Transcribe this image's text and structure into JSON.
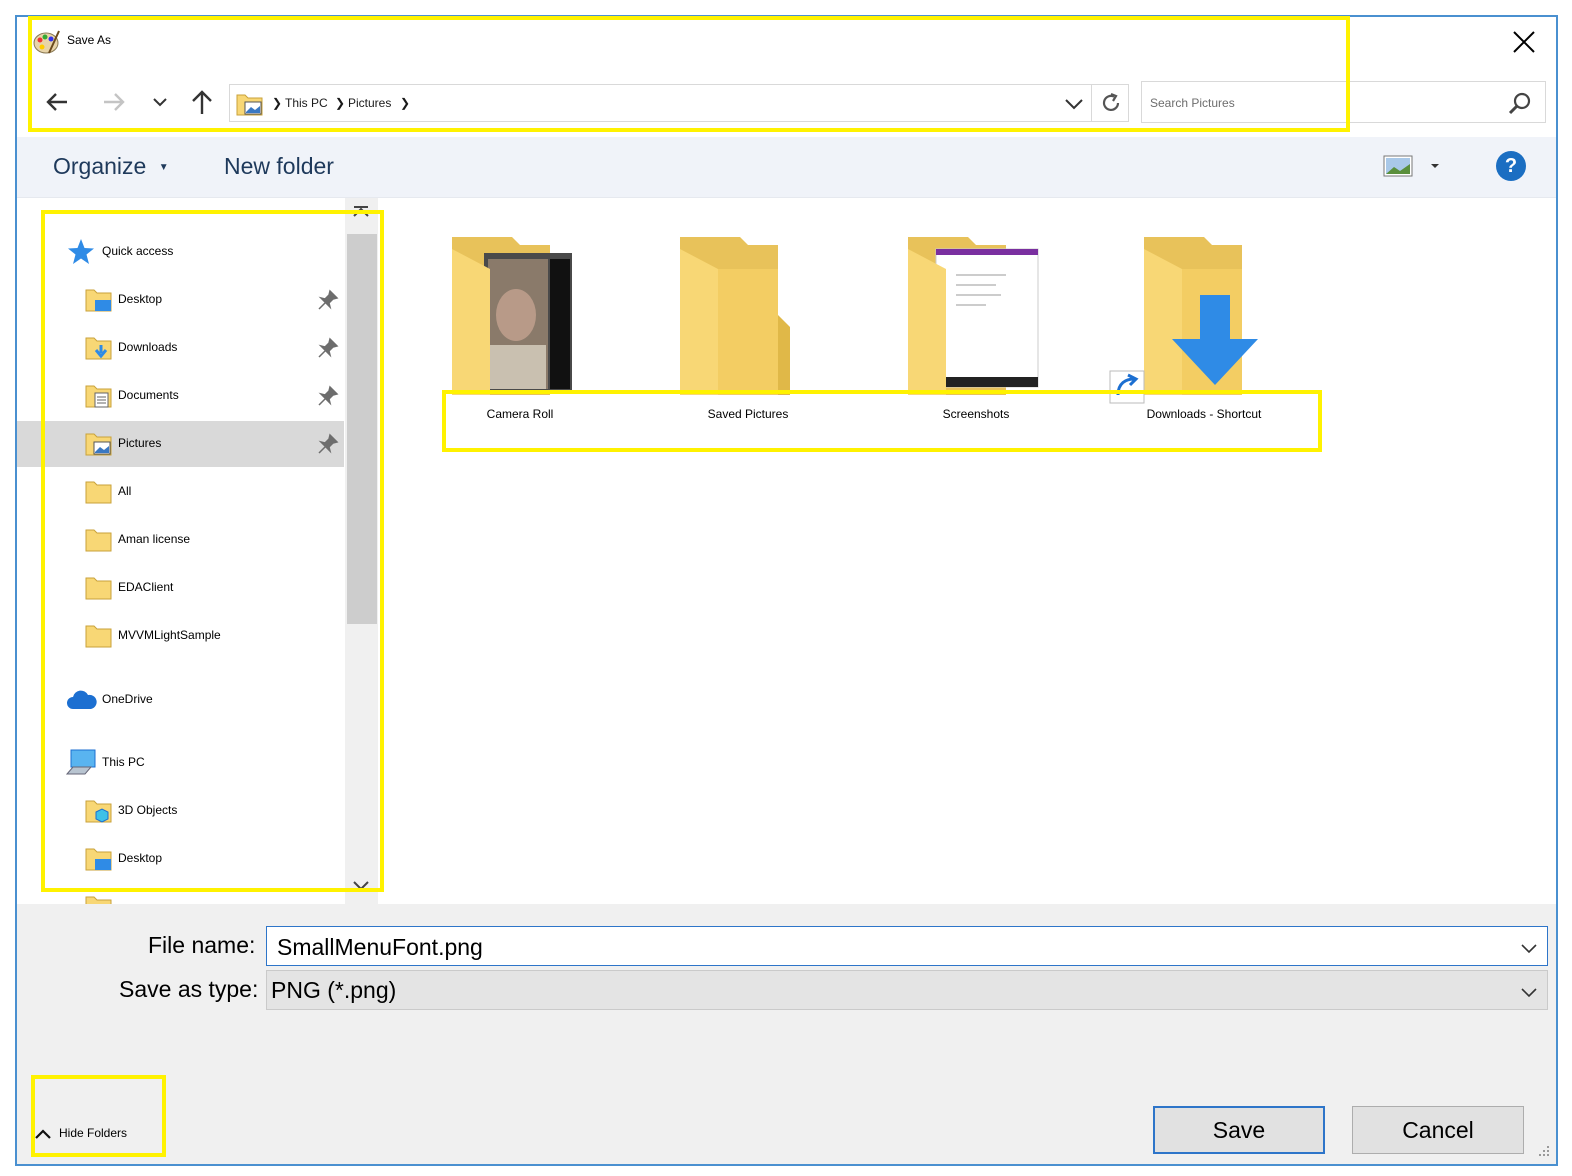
{
  "window": {
    "title": "Save As"
  },
  "address_bar": {
    "crumbs": [
      "This PC",
      "Pictures"
    ]
  },
  "search": {
    "placeholder": "Search Pictures"
  },
  "toolbar": {
    "organize": "Organize",
    "new_folder": "New folder",
    "help": "?"
  },
  "nav": {
    "quick_access": "Quick access",
    "quick_items": [
      {
        "label": "Desktop",
        "icon": "desktop-folder-icon",
        "pinned": true
      },
      {
        "label": "Downloads",
        "icon": "downloads-folder-icon",
        "pinned": true
      },
      {
        "label": "Documents",
        "icon": "documents-folder-icon",
        "pinned": true
      },
      {
        "label": "Pictures",
        "icon": "pictures-folder-icon",
        "pinned": true,
        "selected": true
      },
      {
        "label": "All",
        "icon": "folder-icon"
      },
      {
        "label": "Aman license",
        "icon": "folder-icon"
      },
      {
        "label": "EDAClient",
        "icon": "folder-icon"
      },
      {
        "label": "MVVMLightSample",
        "icon": "folder-icon"
      }
    ],
    "onedrive": "OneDrive",
    "this_pc": "This PC",
    "pc_items": [
      {
        "label": "3D Objects",
        "icon": "3d-objects-folder-icon"
      },
      {
        "label": "Desktop",
        "icon": "desktop-folder-icon"
      }
    ]
  },
  "content": {
    "folders": [
      {
        "name": "Camera Roll",
        "icon": "camera-roll-folder-icon"
      },
      {
        "name": "Saved Pictures",
        "icon": "folder-icon"
      },
      {
        "name": "Screenshots",
        "icon": "screenshots-folder-icon"
      },
      {
        "name": "Downloads - Shortcut",
        "icon": "shortcut-folder-icon"
      }
    ]
  },
  "form": {
    "file_name_label": "File name:",
    "file_name_value": "SmallMenuFont.png",
    "save_as_type_label": "Save as type:",
    "save_as_type_value": "PNG (*.png)"
  },
  "buttons": {
    "save": "Save",
    "cancel": "Cancel",
    "hide_folders": "Hide Folders"
  },
  "colors": {
    "accent": "#2e75c9",
    "highlight": "#fff200",
    "folder": "#f8d775",
    "toolbar_text": "#1e395b"
  }
}
